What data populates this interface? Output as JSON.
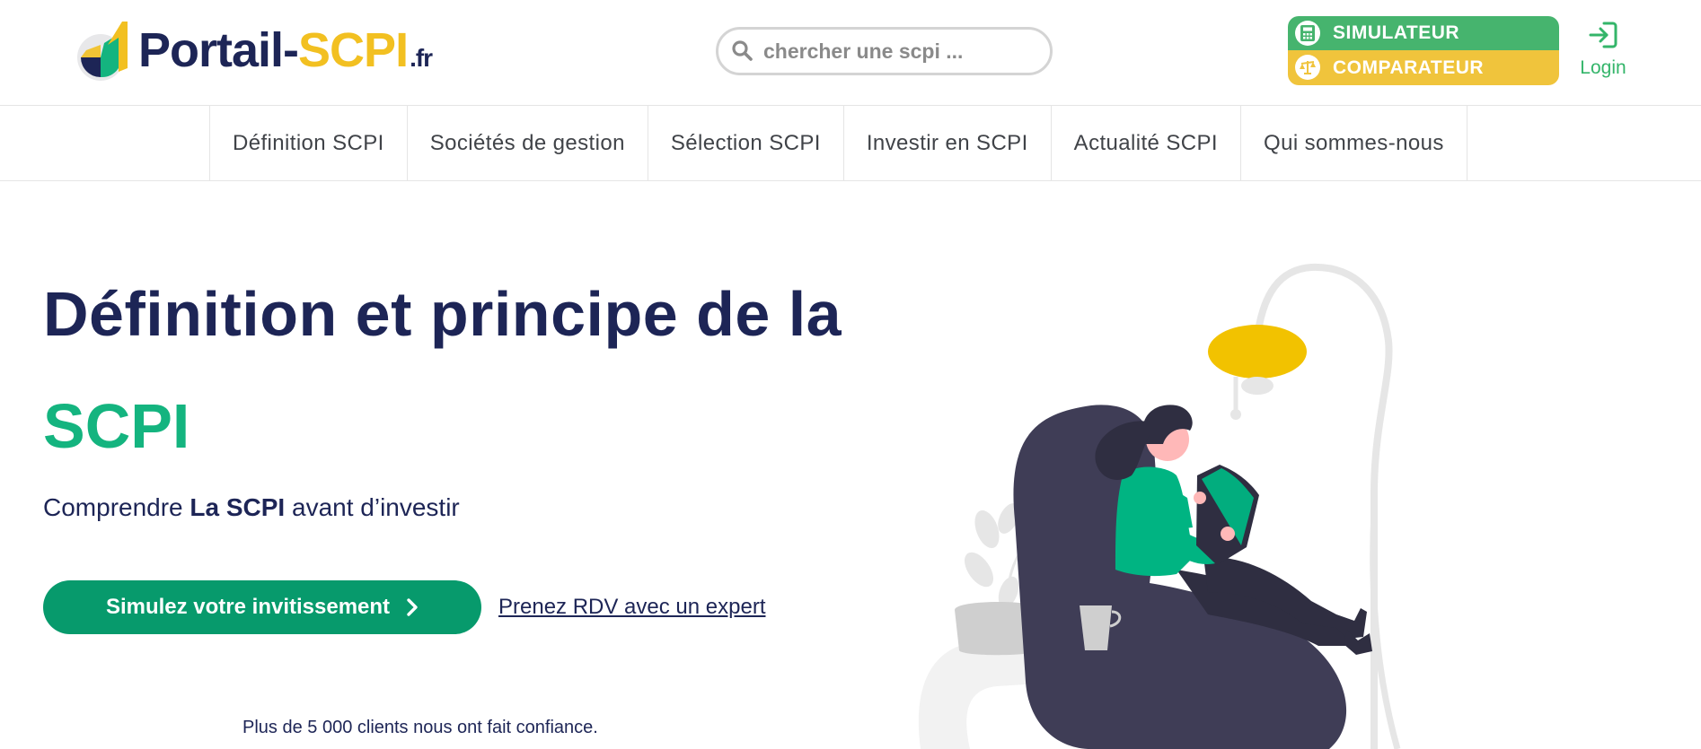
{
  "header": {
    "logo": {
      "portail": "Portail-",
      "scpi": "SCPI",
      "fr": ".fr"
    },
    "search": {
      "placeholder": "chercher une scpi ..."
    },
    "cta": {
      "simulator_label": "SIMULATEUR",
      "comparator_label": "COMPARATEUR"
    },
    "login_label": "Login"
  },
  "nav": {
    "items": [
      {
        "label": "Définition SCPI"
      },
      {
        "label": "Sociétés de gestion"
      },
      {
        "label": "Sélection SCPI"
      },
      {
        "label": "Investir en SCPI"
      },
      {
        "label": "Actualité SCPI"
      },
      {
        "label": "Qui sommes-nous"
      }
    ]
  },
  "hero": {
    "title": "Définition et principe de la",
    "title_accent": "SCPI",
    "subtitle_prefix": "Comprendre ",
    "subtitle_bold": "La SCPI",
    "subtitle_suffix": " avant d’investir",
    "primary_button": "Simulez votre invitissement",
    "secondary_link": "Prenez RDV avec un expert",
    "trust_text": "Plus de 5 000 clients nous ont fait confiance."
  },
  "colors": {
    "navy": "#1d2556",
    "green": "#14b47f",
    "button_green": "#079a6c",
    "yellow": "#f2c021",
    "sim_green": "#46b46e",
    "comp_yellow": "#f0c43c"
  },
  "icons": {
    "search": "search-icon",
    "simulator": "calculator-icon",
    "comparator": "scale-icon",
    "login": "sign-in-icon",
    "chevron": "chevron-right-icon"
  }
}
